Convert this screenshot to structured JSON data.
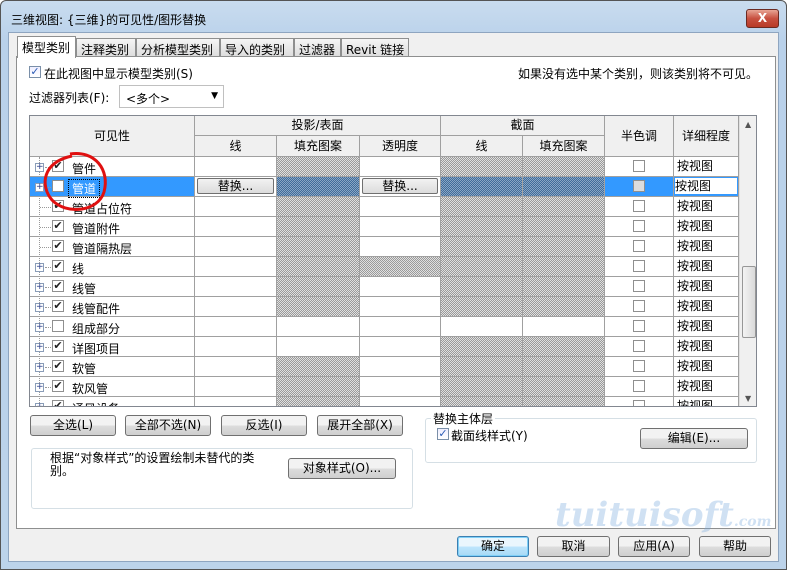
{
  "window": {
    "title": "三维视图: {三维}的可见性/图形替换",
    "close_label": "X"
  },
  "tabs": [
    {
      "label": "模型类别",
      "active": true
    },
    {
      "label": "注释类别"
    },
    {
      "label": "分析模型类别"
    },
    {
      "label": "导入的类别"
    },
    {
      "label": "过滤器"
    },
    {
      "label": "Revit 链接"
    }
  ],
  "options": {
    "show_model_categories": "在此视图中显示模型类别(S)",
    "show_checked": true,
    "hint": "如果没有选中某个类别，则该类别将不可见。",
    "filter_label": "过滤器列表(F):",
    "filter_value": "<多个>"
  },
  "table": {
    "headers": {
      "visibility": "可见性",
      "projection": "投影/表面",
      "section": "截面",
      "line": "线",
      "fill": "填充图案",
      "transparency": "透明度",
      "section_line": "线",
      "section_fill": "填充图案",
      "halftone": "半色调",
      "detail": "详细程度"
    },
    "override_label": "替换...",
    "rows": [
      {
        "name": "管件",
        "checked": true,
        "expandable": true,
        "hatch": [
          0,
          1,
          0,
          1,
          1
        ],
        "detail": "按视图"
      },
      {
        "name": "管道",
        "checked": false,
        "expandable": true,
        "selected": true,
        "hatch": [
          0,
          1,
          0,
          1,
          1
        ],
        "detail": "按视图"
      },
      {
        "name": "管道占位符",
        "checked": true,
        "expandable": false,
        "hatch": [
          0,
          1,
          0,
          1,
          1
        ],
        "detail": "按视图"
      },
      {
        "name": "管道附件",
        "checked": true,
        "expandable": false,
        "hatch": [
          0,
          1,
          0,
          1,
          1
        ],
        "detail": "按视图"
      },
      {
        "name": "管道隔热层",
        "checked": true,
        "expandable": false,
        "hatch": [
          0,
          1,
          0,
          1,
          1
        ],
        "detail": "按视图"
      },
      {
        "name": "线",
        "checked": true,
        "expandable": true,
        "hatch": [
          0,
          1,
          1,
          1,
          1
        ],
        "detail": "按视图"
      },
      {
        "name": "线管",
        "checked": true,
        "expandable": true,
        "hatch": [
          0,
          1,
          0,
          1,
          1
        ],
        "detail": "按视图"
      },
      {
        "name": "线管配件",
        "checked": true,
        "expandable": true,
        "hatch": [
          0,
          1,
          0,
          1,
          1
        ],
        "detail": "按视图"
      },
      {
        "name": "组成部分",
        "checked": false,
        "expandable": true,
        "hatch": [
          0,
          0,
          0,
          0,
          0
        ],
        "detail": "按视图"
      },
      {
        "name": "详图项目",
        "checked": true,
        "expandable": true,
        "hatch": [
          0,
          0,
          0,
          1,
          1
        ],
        "detail": "按视图"
      },
      {
        "name": "软管",
        "checked": true,
        "expandable": true,
        "hatch": [
          0,
          1,
          0,
          1,
          1
        ],
        "detail": "按视图"
      },
      {
        "name": "软风管",
        "checked": true,
        "expandable": true,
        "hatch": [
          0,
          1,
          0,
          1,
          1
        ],
        "detail": "按视图"
      },
      {
        "name": "通风设备",
        "checked": true,
        "expandable": true,
        "hatch": [
          0,
          1,
          0,
          1,
          1
        ],
        "detail": "按视图"
      }
    ]
  },
  "buttons": {
    "select_all": "全选(L)",
    "select_none": "全部不选(N)",
    "invert": "反选(I)",
    "expand_all": "展开全部(X)",
    "object_styles": "对象样式(O)...",
    "edit": "编辑(E)...",
    "ok": "确定",
    "cancel": "取消",
    "apply": "应用(A)",
    "help": "帮助"
  },
  "object_styles_note": "根据“对象样式”的设置绘制未替代的类别。",
  "host_layers": {
    "title": "替换主体层",
    "cut_line_styles": "截面线样式(Y)",
    "checked": true
  },
  "watermark": "tuituisoft.com",
  "colors": {
    "selection": "#3399ff",
    "annotation": "#e01010"
  }
}
